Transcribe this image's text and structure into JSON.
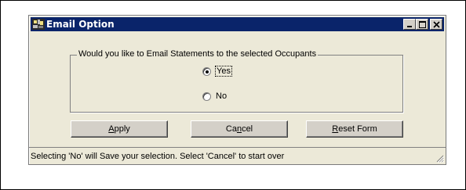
{
  "window": {
    "title": "Email Option",
    "accent": "#0a246a",
    "face": "#ece9d8"
  },
  "caption_buttons": [
    "minimize-icon",
    "maximize-icon",
    "close-icon"
  ],
  "group": {
    "legend": "Would you like to Email Statements to the selected Occupants",
    "options": [
      {
        "label": "Yes",
        "checked": true
      },
      {
        "label": "No",
        "checked": false
      }
    ]
  },
  "buttons": {
    "apply": {
      "pre": "",
      "key": "A",
      "post": "pply"
    },
    "cancel": {
      "pre": "Ca",
      "key": "n",
      "post": "cel"
    },
    "reset": {
      "pre": "",
      "key": "R",
      "post": "eset Form"
    }
  },
  "status": "Selecting 'No' will Save your selection. Select 'Cancel' to start over"
}
